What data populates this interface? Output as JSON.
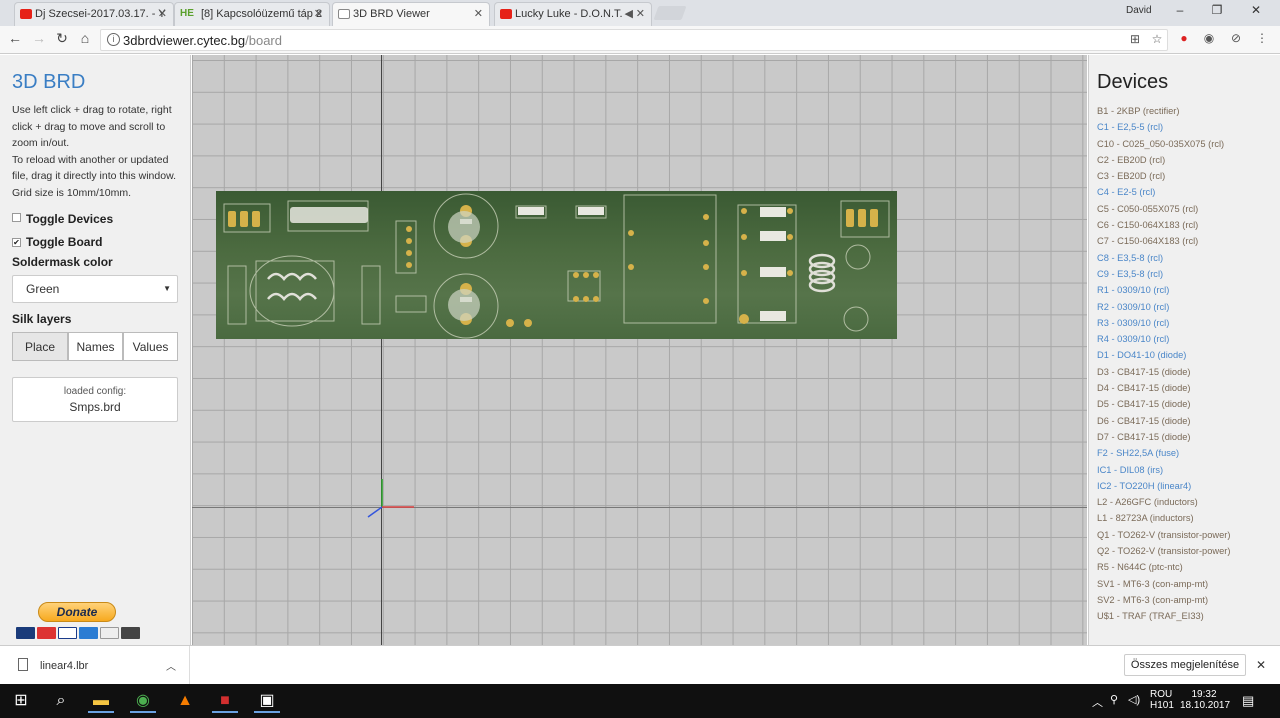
{
  "browser": {
    "tabs": [
      {
        "title": "Dj Szecsei-2017.03.17. - ​Y",
        "fav_color": "#e62117"
      },
      {
        "title": "[8] Kapcsolóüzemű táp 2",
        "fav_color": "#5aa02c"
      },
      {
        "title": "3D BRD Viewer",
        "fav_color": ""
      },
      {
        "title": "Lucky Luke - D.O.N.T.",
        "fav_color": "#e62117"
      }
    ],
    "user": "David",
    "url_host": "3dbrdviewer.cytec.bg",
    "url_path": "/board"
  },
  "sidebar": {
    "title": "3D BRD",
    "help_lines": [
      "Use left click + drag to rotate, right click + drag to move and scroll to zoom in/out.",
      "To reload with another or updated file, drag it directly into this window.",
      "Grid size is 10mm/10mm."
    ],
    "toggle_devices": "Toggle Devices",
    "toggle_board": "Toggle Board",
    "toggle_board_checked": true,
    "soldermask_label": "Soldermask color",
    "soldermask_value": "Green",
    "silk_label": "Silk layers",
    "silk_buttons": [
      "Place",
      "Names",
      "Values"
    ],
    "config_label": "loaded config:",
    "config_value": "Smps.brd",
    "donate_label": "Donate"
  },
  "devices": {
    "title": "Devices",
    "items": [
      {
        "label": "B1 - 2KBP (rectifier)",
        "selected": false
      },
      {
        "label": "C1 - E2,5-5 (rcl)",
        "selected": true
      },
      {
        "label": "C10 - C025_050-035X075 (rcl)",
        "selected": false
      },
      {
        "label": "C2 - EB20D (rcl)",
        "selected": false
      },
      {
        "label": "C3 - EB20D (rcl)",
        "selected": false
      },
      {
        "label": "C4 - E2-5 (rcl)",
        "selected": true
      },
      {
        "label": "C5 - C050-055X075 (rcl)",
        "selected": false
      },
      {
        "label": "C6 - C150-064X183 (rcl)",
        "selected": false
      },
      {
        "label": "C7 - C150-064X183 (rcl)",
        "selected": false
      },
      {
        "label": "C8 - E3,5-8 (rcl)",
        "selected": true
      },
      {
        "label": "C9 - E3,5-8 (rcl)",
        "selected": true
      },
      {
        "label": "R1 - 0309/10 (rcl)",
        "selected": true
      },
      {
        "label": "R2 - 0309/10 (rcl)",
        "selected": true
      },
      {
        "label": "R3 - 0309/10 (rcl)",
        "selected": true
      },
      {
        "label": "R4 - 0309/10 (rcl)",
        "selected": true
      },
      {
        "label": "D1 - DO41-10 (diode)",
        "selected": true
      },
      {
        "label": "D3 - CB417-15 (diode)",
        "selected": false
      },
      {
        "label": "D4 - CB417-15 (diode)",
        "selected": false
      },
      {
        "label": "D5 - CB417-15 (diode)",
        "selected": false
      },
      {
        "label": "D6 - CB417-15 (diode)",
        "selected": false
      },
      {
        "label": "D7 - CB417-15 (diode)",
        "selected": false
      },
      {
        "label": "F2 - SH22,5A (fuse)",
        "selected": true
      },
      {
        "label": "IC1 - DIL08 (irs)",
        "selected": true
      },
      {
        "label": "IC2 - TO220H (linear4)",
        "selected": true
      },
      {
        "label": "L2 - A26GFC (inductors)",
        "selected": false
      },
      {
        "label": "L1 - 82723A (inductors)",
        "selected": false
      },
      {
        "label": "Q1 - TO262-V (transistor-power)",
        "selected": false
      },
      {
        "label": "Q2 - TO262-V (transistor-power)",
        "selected": false
      },
      {
        "label": "R5 - N644C (ptc-ntc)",
        "selected": false
      },
      {
        "label": "SV1 - MT6-3 (con-amp-mt)",
        "selected": false
      },
      {
        "label": "SV2 - MT6-3 (con-amp-mt)",
        "selected": false
      },
      {
        "label": "U$1 - TRAF (TRAF_EI33)",
        "selected": false
      }
    ]
  },
  "downloads": {
    "file": "linear4.lbr",
    "show_all": "Összes megjelenítése"
  },
  "taskbar": {
    "lang_top": "ROU",
    "lang_bottom": "H101",
    "time": "19:32",
    "date": "18.10.2017"
  }
}
